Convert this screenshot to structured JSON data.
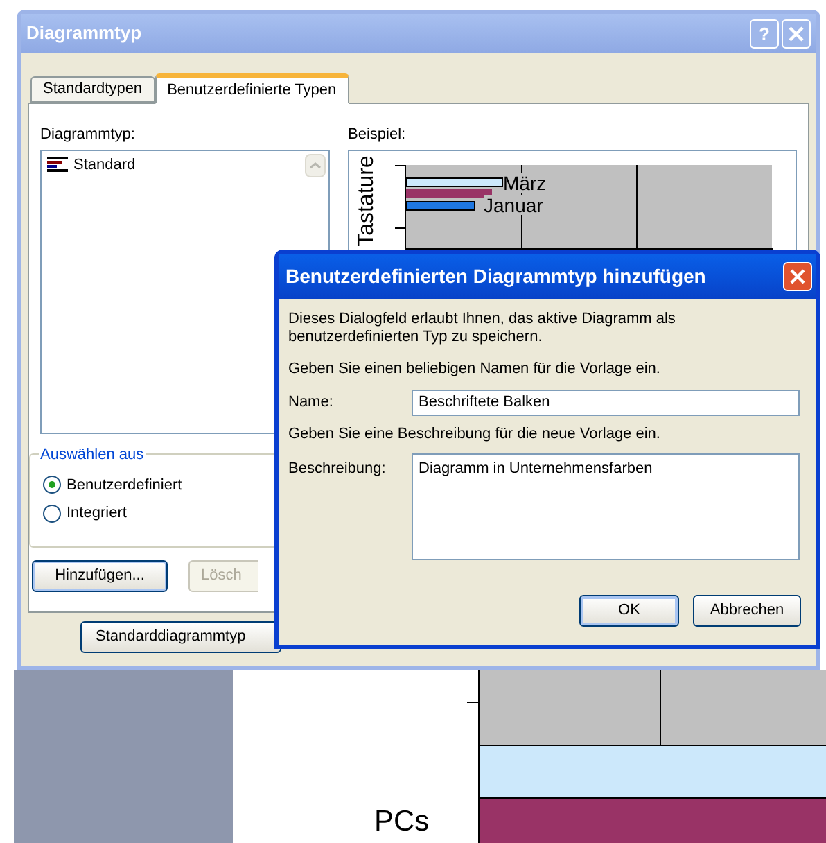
{
  "main_dialog": {
    "title": "Diagrammtyp",
    "help_label": "?",
    "tabs": [
      {
        "label": "Standardtypen",
        "selected": false
      },
      {
        "label": "Benutzerdefinierte Typen",
        "selected": true
      }
    ],
    "chart_types": {
      "label": "Diagrammtyp:",
      "items": [
        {
          "label": "Standard",
          "selected": false
        }
      ]
    },
    "preview": {
      "label": "Beispiel:",
      "axis_title": "Tastature",
      "bar_labels": [
        "März",
        "Januar"
      ]
    },
    "select_from": {
      "label": "Auswählen aus",
      "options": [
        {
          "label": "Benutzerdefiniert",
          "selected": true
        },
        {
          "label": "Integriert",
          "selected": false
        }
      ]
    },
    "buttons": [
      {
        "label": "Hinzufügen...",
        "disabled": false
      },
      {
        "label": "Lösch",
        "disabled": true
      }
    ],
    "default_button": "Standarddiagrammtyp"
  },
  "add_dialog": {
    "title": "Benutzerdefinierten Diagrammtyp hinzufügen",
    "intro": "Dieses Dialogfeld erlaubt Ihnen, das aktive Diagramm als benutzerdefinierten Typ zu speichern.",
    "name_prompt": "Geben Sie einen beliebigen Namen für die Vorlage ein.",
    "name_label": "Name:",
    "name_value": "Beschriftete Balken",
    "description_prompt": "Geben Sie eine Beschreibung für die neue Vorlage ein.",
    "description_label": "Beschreibung:",
    "description_value": "Diagramm in Unternehmensfarben",
    "buttons": [
      {
        "label": "OK",
        "default": true
      },
      {
        "label": "Abbrechen",
        "default": false
      }
    ]
  },
  "background_chart": {
    "category_label": "PCs"
  }
}
